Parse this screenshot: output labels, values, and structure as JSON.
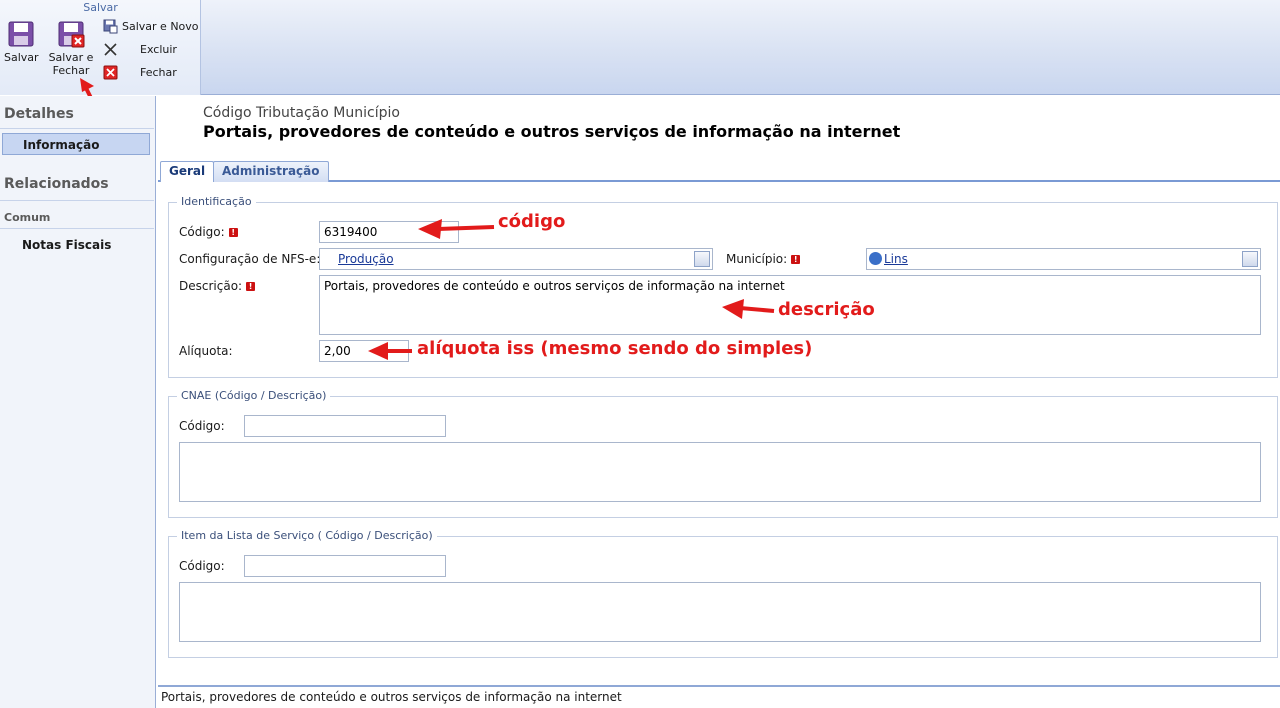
{
  "ribbon": {
    "group_title": "Salvar",
    "salvar_label": "Salvar",
    "salvar_fechar_label_line1": "Salvar e",
    "salvar_fechar_label_line2": "Fechar",
    "salvar_novo_label": "Salvar e Novo",
    "excluir_label": "Excluir",
    "fechar_label": "Fechar"
  },
  "leftnav": {
    "detalhes_header": "Detalhes",
    "informacao_item": "Informação",
    "relacionados_header": "Relacionados",
    "comum_sub": "Comum",
    "notas_fiscais_item": "Notas Fiscais"
  },
  "header": {
    "entity_type": "Código Tributação Município",
    "title": "Portais, provedores de conteúdo e outros serviços de informação na internet"
  },
  "tabs": [
    {
      "label": "Geral",
      "active": true
    },
    {
      "label": "Administração",
      "active": false
    }
  ],
  "identificacao": {
    "legend": "Identificação",
    "codigo_label": "Código:",
    "codigo_value": "6319400",
    "config_nfse_label": "Configuração de NFS-e:",
    "config_nfse_value": "Produção",
    "municipio_label": "Município:",
    "municipio_value": "Lins",
    "descricao_label": "Descrição:",
    "descricao_value": "Portais, provedores de conteúdo e outros serviços de informação na internet",
    "aliquota_label": "Alíquota:",
    "aliquota_value": "2,00"
  },
  "cnae": {
    "legend": "CNAE (Código / Descrição)",
    "codigo_label": "Código:"
  },
  "item_lista": {
    "legend": "Item da Lista de Serviço ( Código / Descrição)",
    "codigo_label": "Código:"
  },
  "annotations": {
    "codigo": "código",
    "descricao": "descrição",
    "aliquota": "alíquota iss (mesmo sendo do simples)"
  },
  "statusbar": {
    "text": "Portais, provedores de conteúdo e outros serviços de informação na internet"
  },
  "colors": {
    "annotation": "#e21b1b",
    "accent": "#3a5a96",
    "required": "#cc1111"
  }
}
